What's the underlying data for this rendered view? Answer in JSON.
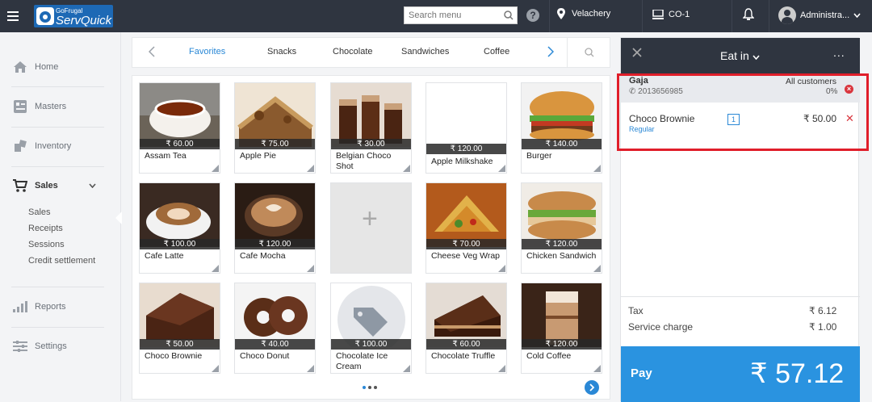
{
  "header": {
    "brand_small": "GoFrugal",
    "brand": "ServQuick",
    "search_placeholder": "Search menu",
    "help": "?",
    "location": "Velachery",
    "register": "CO-1",
    "user": "Administra..."
  },
  "sidebar": {
    "items": [
      {
        "label": "Home",
        "icon": "home-icon"
      },
      {
        "label": "Masters",
        "icon": "masters-icon"
      },
      {
        "label": "Inventory",
        "icon": "inventory-icon"
      },
      {
        "label": "Sales",
        "icon": "cart-icon"
      },
      {
        "label": "Reports",
        "icon": "reports-icon"
      },
      {
        "label": "Settings",
        "icon": "settings-icon"
      }
    ],
    "sales_sub": [
      "Sales",
      "Receipts",
      "Sessions",
      "Credit settlement"
    ]
  },
  "categories": {
    "tabs": [
      "Favorites",
      "Snacks",
      "Chocolate",
      "Sandwiches",
      "Coffee"
    ],
    "active": "Favorites"
  },
  "menu_items": [
    {
      "name": "Assam Tea",
      "price": "₹ 60.00"
    },
    {
      "name": "Apple Pie",
      "price": "₹ 75.00"
    },
    {
      "name": "Belgian Choco Shot",
      "price": "₹ 30.00"
    },
    {
      "name": "Apple Milkshake",
      "price": "₹ 120.00"
    },
    {
      "name": "Burger",
      "price": "₹ 140.00"
    },
    {
      "name": "Cafe Latte",
      "price": "₹ 100.00"
    },
    {
      "name": "Cafe Mocha",
      "price": "₹ 120.00"
    },
    {
      "name": "",
      "price": ""
    },
    {
      "name": "Cheese Veg Wrap",
      "price": "₹ 70.00"
    },
    {
      "name": "Chicken Sandwich",
      "price": "₹ 120.00"
    },
    {
      "name": "Choco Brownie",
      "price": "₹ 50.00"
    },
    {
      "name": "Choco Donut",
      "price": "₹ 40.00"
    },
    {
      "name": "Chocolate Ice Cream",
      "price": "₹ 100.00"
    },
    {
      "name": "Chocolate Truffle",
      "price": "₹ 60.00"
    },
    {
      "name": "Cold Coffee",
      "price": "₹ 120.00"
    }
  ],
  "order": {
    "type": "Eat in",
    "more": "...",
    "customer": {
      "name": "Gaja",
      "phone": "2013656985",
      "group": "All customers",
      "discount": "0%"
    },
    "items": [
      {
        "name": "Choco Brownie",
        "variant": "Regular",
        "qty": "1",
        "amount": "₹ 50.00"
      }
    ],
    "tax_label": "Tax",
    "tax": "₹ 6.12",
    "service_label": "Service charge",
    "service": "₹ 1.00",
    "pay_label": "Pay",
    "total": "₹ 57.12"
  },
  "colors": {
    "topbar": "#2f3540",
    "accent": "#2a88d6",
    "pay": "#2a93e0",
    "highlight": "#e01e2a"
  }
}
